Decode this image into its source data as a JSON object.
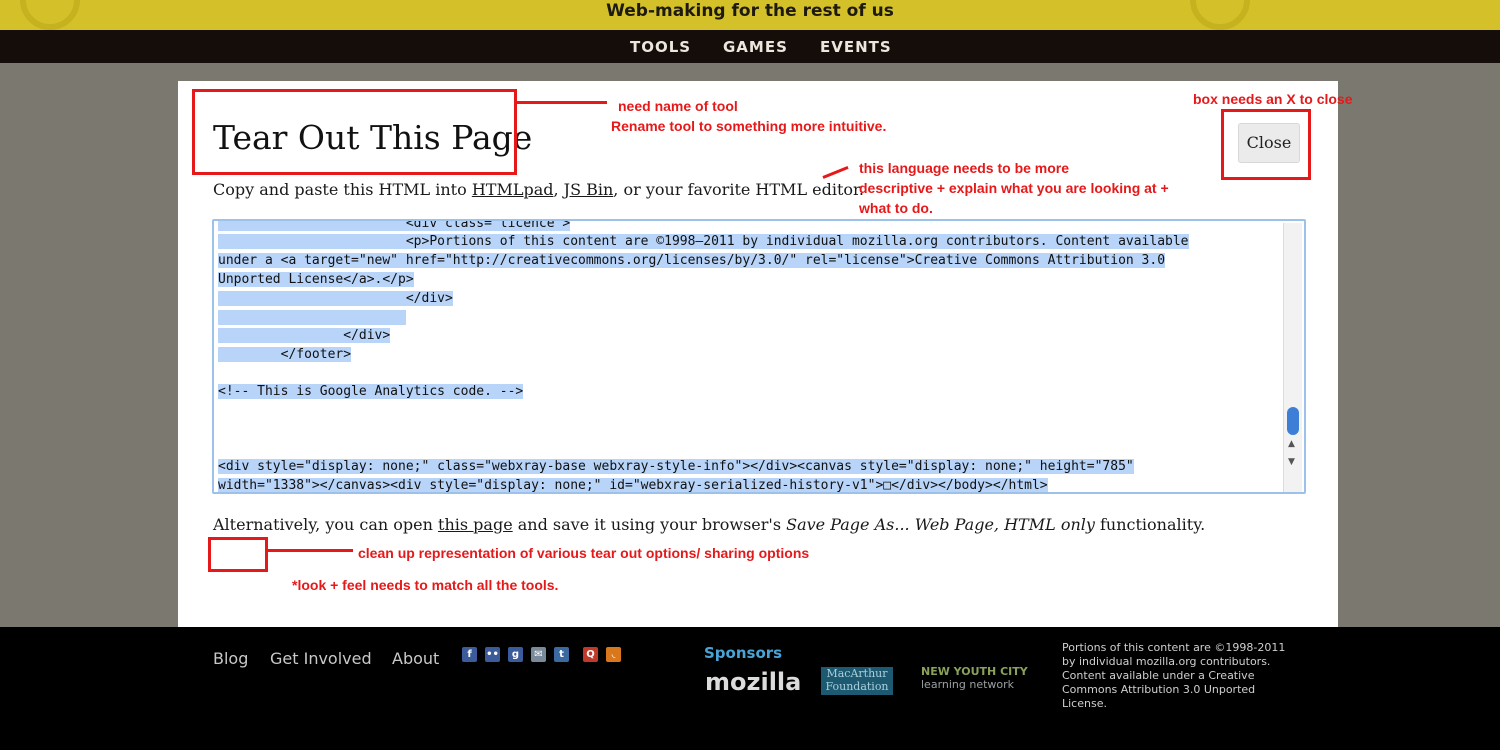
{
  "header": {
    "tagline": "Web-making for the rest of us",
    "nav": [
      "TOOLS",
      "GAMES",
      "EVENTS"
    ]
  },
  "dialog": {
    "title": "Tear Out This Page",
    "copy_prefix": "Copy and paste this HTML into ",
    "link_htmlpad": "HTMLpad",
    "sep1": ", ",
    "link_jsbin": "JS Bin",
    "copy_suffix": ", or your favorite HTML editor.",
    "close_label": "Close",
    "code_lines": [
      "                        <div class=\"licence\">",
      "                        <p>Portions of this content are ©1998–2011 by individual mozilla.org contributors. Content available",
      "under a <a target=\"new\" href=\"http://creativecommons.org/licenses/by/3.0/\" rel=\"license\">Creative Commons Attribution 3.0",
      "Unported License</a>.</p>",
      "                        </div>",
      "                        ",
      "                </div>",
      "        </footer>",
      "",
      "<!-- This is Google Analytics code. -->",
      "",
      "",
      "",
      "<div style=\"display: none;\" class=\"webxray-base webxray-style-info\"></div><canvas style=\"display: none;\" height=\"785\"",
      "width=\"1338\"></canvas><div style=\"display: none;\" id=\"webxray-serialized-history-v1\">□</div></body></html>"
    ],
    "alt_prefix": "Alternatively, you can open ",
    "alt_link": "this page",
    "alt_mid": " and save it using your browser's ",
    "alt_em": "Save Page As... Web Page, HTML only",
    "alt_suffix": " functionality."
  },
  "annotations": {
    "note_name": "need name of tool",
    "note_rename": "Rename tool to something more intuitive.",
    "note_close": "box needs an X to close",
    "note_lang1": "this language needs to be more",
    "note_lang2": "descriptive + explain what you are looking at +",
    "note_lang3": "what to do.",
    "note_cleanup": "clean up representation of various tear out options/ sharing options",
    "note_look": "*look + feel needs to match all the tools."
  },
  "footer": {
    "links": [
      "Blog",
      "Get Involved",
      "About"
    ],
    "social_icons": [
      "facebook-icon",
      "flickr-icon",
      "google-icon",
      "email-icon",
      "twitter-icon",
      "quora-icon",
      "rss-icon"
    ],
    "sponsors_label": "Sponsors",
    "mozilla": "mozilla",
    "macarthur_line1": "MacArthur",
    "macarthur_line2": "Foundation",
    "nycl_line1": "NEW YOUTH CITY",
    "nycl_line2": "learning network",
    "license": "Portions of this content are ©1998-2011 by individual mozilla.org contributors. Content available under a Creative Commons Attribution 3.0 Unported License."
  },
  "colors": {
    "annotation_red": "#e6191a",
    "header_yellow": "#d4c12a",
    "selection_blue": "#b8d4f9"
  }
}
